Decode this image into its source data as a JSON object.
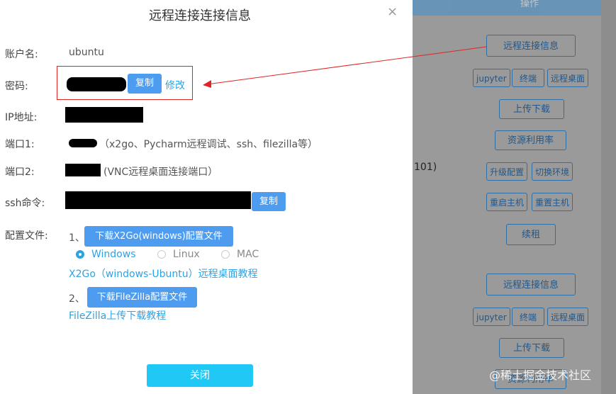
{
  "dialog": {
    "title": "远程连接连接信息",
    "close_icon": "×",
    "account": {
      "label": "账户名:",
      "value": "ubuntu"
    },
    "password": {
      "label": "密码:",
      "copy": "复制",
      "edit": "修改"
    },
    "ip": {
      "label": "IP地址:"
    },
    "port1": {
      "label": "端口1:",
      "note": "（x2go、Pycharm远程调试、ssh、filezilla等）"
    },
    "port2": {
      "label": "端口2:",
      "note": "(VNC远程桌面连接端口）"
    },
    "ssh": {
      "label": "ssh命令:",
      "copy": "复制"
    },
    "config": {
      "label": "配置文件:",
      "step1": "1、",
      "download_x2go": "下载X2Go(windows)配置文件",
      "os_options": [
        "Windows",
        "Linux",
        "MAC"
      ],
      "selected_os": "Windows",
      "x2go_tutorial": "X2Go（windows-Ubuntu）远程桌面教程",
      "step2": "2、",
      "download_filezilla": "下载FileZilla配置文件",
      "filezilla_tutorial": "FileZilla上传下载教程"
    },
    "footer_close": "关闭"
  },
  "background": {
    "header": "操作",
    "partial_text": "101)",
    "group1": {
      "remote_info": "远程连接信息",
      "jupyter": "jupyter",
      "terminal": "终端",
      "remote_desktop": "远程桌面",
      "upload_download": "上传下载",
      "resource_usage": "资源利用率",
      "upgrade": "升级配置",
      "switch_env": "切换环境",
      "restart": "重启主机",
      "reset": "重置主机",
      "renew": "续租"
    },
    "group2": {
      "remote_info": "远程连接信息",
      "jupyter": "jupyter",
      "terminal": "终端",
      "remote_desktop": "远程桌面",
      "upload_download": "上传下载",
      "resource_usage": "资源利用率"
    }
  },
  "watermark": "@稀土掘金技术社区",
  "colors": {
    "primary": "#4d9cf0",
    "link": "#2ba3e6",
    "annotation": "#e02424",
    "footer_button": "#1fc8f5"
  }
}
